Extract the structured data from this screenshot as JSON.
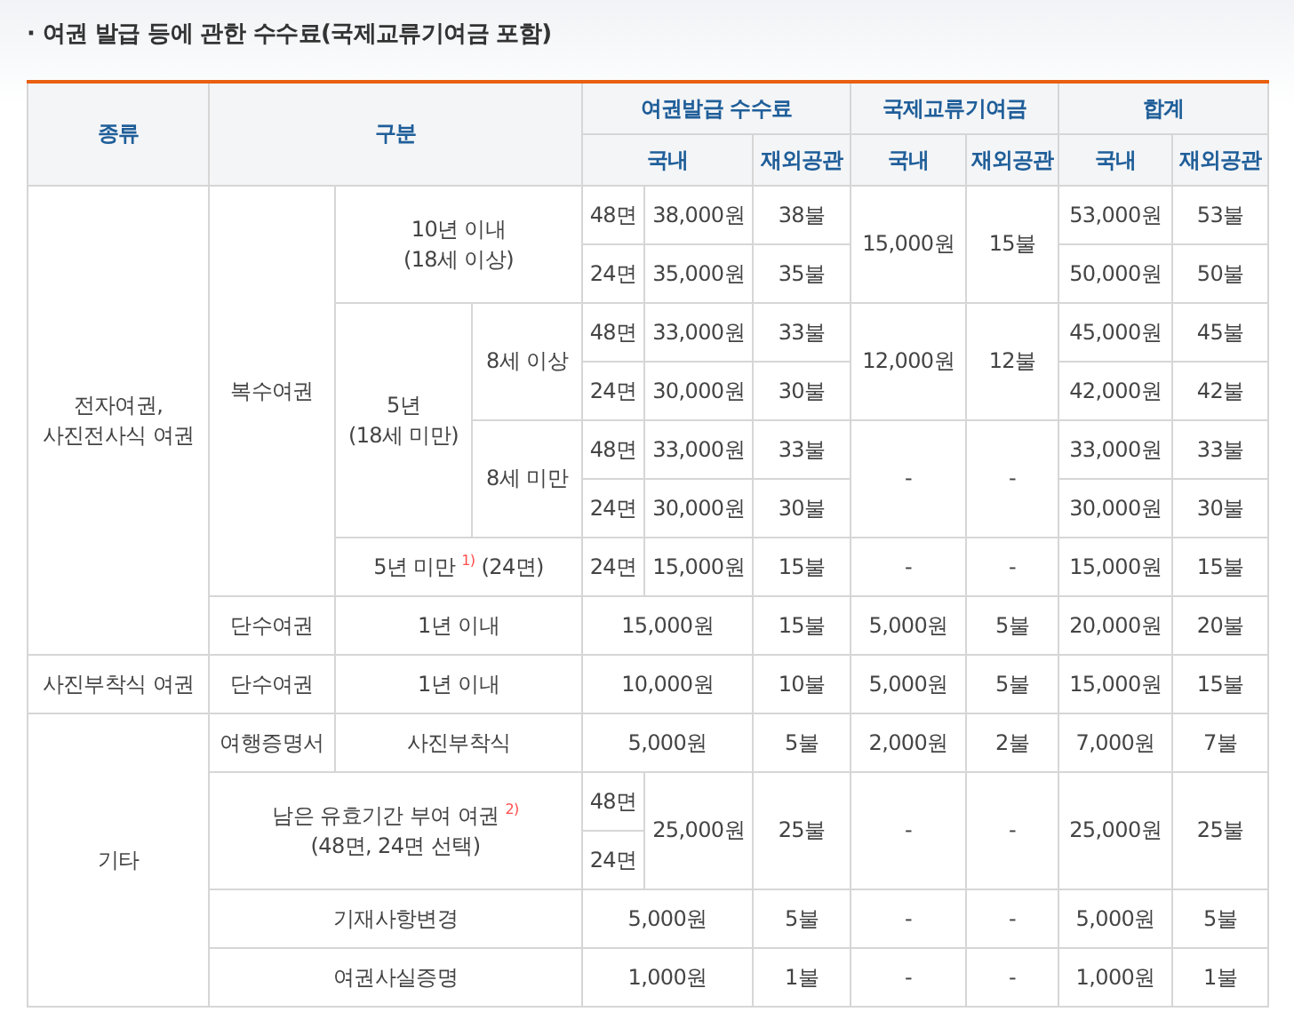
{
  "title": "· 여권 발급 등에 관한 수수료(국제교류기여금 포함)",
  "table": {
    "header_rows": [
      [
        {
          "text": "종류",
          "rowspan": 2
        },
        {
          "text": "구분",
          "rowspan": 2,
          "colspan": 3
        },
        {
          "text": "여권발급 수수료",
          "colspan": 3
        },
        {
          "text": "국제교류기여금",
          "colspan": 2
        },
        {
          "text": "합계",
          "colspan": 2
        }
      ],
      [
        {
          "text": "국내",
          "colspan": 2
        },
        {
          "text": "재외공관"
        },
        {
          "text": "국내"
        },
        {
          "text": "재외공관"
        },
        {
          "text": "국내"
        },
        {
          "text": "재외공관"
        }
      ]
    ],
    "rows": [
      [
        {
          "text": "전자여권,\n사진전사식 여권",
          "rowspan": 8
        },
        {
          "text": "복수여권",
          "rowspan": 7
        },
        {
          "text": "10년 이내\n(18세 이상)",
          "rowspan": 2,
          "colspan": 2
        },
        {
          "text": "48면"
        },
        {
          "text": "38,000원"
        },
        {
          "text": "38불"
        },
        {
          "text": "15,000원",
          "rowspan": 2
        },
        {
          "text": "15불",
          "rowspan": 2
        },
        {
          "text": "53,000원"
        },
        {
          "text": "53불"
        }
      ],
      [
        {
          "text": "24면"
        },
        {
          "text": "35,000원"
        },
        {
          "text": "35불"
        },
        {
          "text": "50,000원"
        },
        {
          "text": "50불"
        }
      ],
      [
        {
          "text": "5년\n(18세 미만)",
          "rowspan": 4
        },
        {
          "text": "8세 이상",
          "rowspan": 2
        },
        {
          "text": "48면"
        },
        {
          "text": "33,000원"
        },
        {
          "text": "33불"
        },
        {
          "text": "12,000원",
          "rowspan": 2
        },
        {
          "text": "12불",
          "rowspan": 2
        },
        {
          "text": "45,000원"
        },
        {
          "text": "45불"
        }
      ],
      [
        {
          "text": "24면"
        },
        {
          "text": "30,000원"
        },
        {
          "text": "30불"
        },
        {
          "text": "42,000원"
        },
        {
          "text": "42불"
        }
      ],
      [
        {
          "text": "8세 미만",
          "rowspan": 2
        },
        {
          "text": "48면"
        },
        {
          "text": "33,000원"
        },
        {
          "text": "33불"
        },
        {
          "text": "-",
          "rowspan": 2
        },
        {
          "text": "-",
          "rowspan": 2
        },
        {
          "text": "33,000원"
        },
        {
          "text": "33불"
        }
      ],
      [
        {
          "text": "24면"
        },
        {
          "text": "30,000원"
        },
        {
          "text": "30불"
        },
        {
          "text": "30,000원"
        },
        {
          "text": "30불"
        }
      ],
      [
        {
          "text": "5년 미만 $^{1)}$ (24면)",
          "colspan": 2
        },
        {
          "text": "24면"
        },
        {
          "text": "15,000원"
        },
        {
          "text": "15불"
        },
        {
          "text": "-"
        },
        {
          "text": "-"
        },
        {
          "text": "15,000원"
        },
        {
          "text": "15불"
        }
      ],
      [
        {
          "text": "단수여권"
        },
        {
          "text": "1년 이내",
          "colspan": 2
        },
        {
          "text": "15,000원",
          "colspan": 2
        },
        {
          "text": "15불"
        },
        {
          "text": "5,000원"
        },
        {
          "text": "5불"
        },
        {
          "text": "20,000원"
        },
        {
          "text": "20불"
        }
      ],
      [
        {
          "text": "사진부착식 여권"
        },
        {
          "text": "단수여권"
        },
        {
          "text": "1년 이내",
          "colspan": 2
        },
        {
          "text": "10,000원",
          "colspan": 2
        },
        {
          "text": "10불"
        },
        {
          "text": "5,000원"
        },
        {
          "text": "5불"
        },
        {
          "text": "15,000원"
        },
        {
          "text": "15불"
        }
      ],
      [
        {
          "text": "기타",
          "rowspan": 5
        },
        {
          "text": "여행증명서"
        },
        {
          "text": "사진부착식",
          "colspan": 2
        },
        {
          "text": "5,000원",
          "colspan": 2
        },
        {
          "text": "5불"
        },
        {
          "text": "2,000원"
        },
        {
          "text": "2불"
        },
        {
          "text": "7,000원"
        },
        {
          "text": "7불"
        }
      ],
      [
        {
          "text": "남은 유효기간 부여 여권 $^{2)}$\n(48면, 24면 선택)",
          "rowspan": 2,
          "colspan": 3
        },
        {
          "text": "48면"
        },
        {
          "text": "25,000원",
          "rowspan": 2
        },
        {
          "text": "25불",
          "rowspan": 2
        },
        {
          "text": "-",
          "rowspan": 2
        },
        {
          "text": "-",
          "rowspan": 2
        },
        {
          "text": "25,000원",
          "rowspan": 2
        },
        {
          "text": "25불",
          "rowspan": 2
        }
      ],
      [
        {
          "text": "24면"
        }
      ],
      [
        {
          "text": "기재사항변경",
          "colspan": 3
        },
        {
          "text": "5,000원",
          "colspan": 2
        },
        {
          "text": "5불"
        },
        {
          "text": "-"
        },
        {
          "text": "-"
        },
        {
          "text": "5,000원"
        },
        {
          "text": "5불"
        }
      ],
      [
        {
          "text": "여권사실증명",
          "colspan": 3
        },
        {
          "text": "1,000원",
          "colspan": 2
        },
        {
          "text": "1불"
        },
        {
          "text": "-"
        },
        {
          "text": "-"
        },
        {
          "text": "1,000원"
        },
        {
          "text": "1불"
        }
      ]
    ]
  }
}
